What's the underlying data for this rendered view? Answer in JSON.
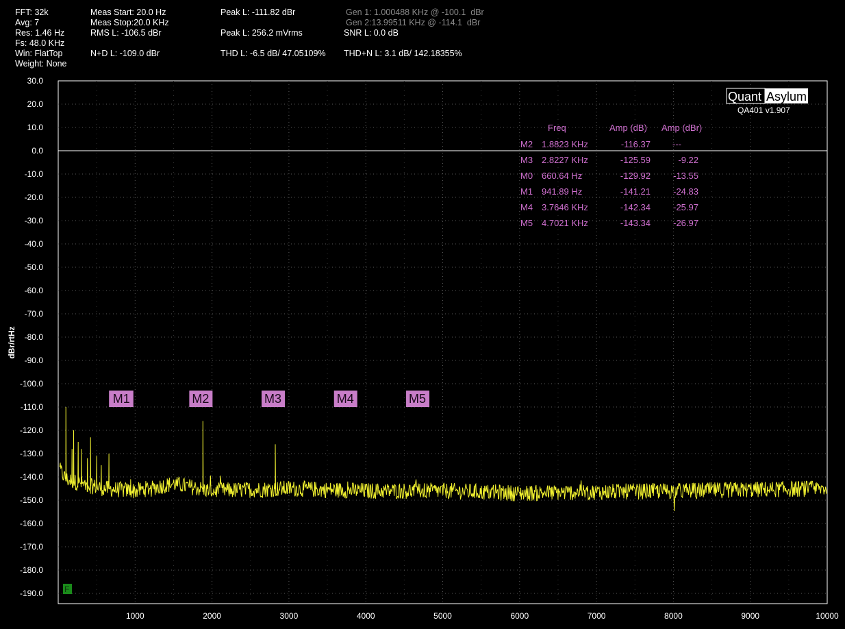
{
  "stats": {
    "fft": "FFT: 32k",
    "avg": "Avg: 7",
    "res": "Res: 1.46 Hz",
    "fs": "Fs: 48.0 KHz",
    "win": "Win: FlatTop",
    "weight": "Weight: None",
    "meas_start": "Meas Start: 20.0 Hz",
    "meas_stop": "Meas Stop:20.0 KHz",
    "rms": "RMS L: -106.5 dBr",
    "nd": "N+D L: -109.0 dBr",
    "peak_dbr": "Peak L: -111.82 dBr",
    "peak_mv": "Peak L: 256.2 mVrms",
    "thd": "THD L: -6.5 dB/ 47.05109%",
    "gen1": "Gen 1: 1.000488 KHz @ -100.1  dBr",
    "gen2": "Gen 2:13.99511 KHz @ -114.1  dBr",
    "snr": "SNR L: 0.0 dB",
    "thdn": "THD+N L: 3.1 dB/ 142.18355%"
  },
  "logo": {
    "quant": "Quant",
    "asylum": "Asylum",
    "version": "QA401 v1.907"
  },
  "colors": {
    "trace": "#f2f230",
    "marker": "#c87dc8",
    "table": "#d070d0",
    "grid": "#5a5a5a"
  },
  "badge": "F",
  "chart_data": {
    "type": "line",
    "xlim": [
      0,
      10000
    ],
    "ylim": [
      -195,
      30
    ],
    "ylabel": "dBr/rtHz",
    "xticks": [
      "1000",
      "2000",
      "3000",
      "4000",
      "5000",
      "6000",
      "7000",
      "8000",
      "9000",
      "10000"
    ],
    "yticks": [
      "30.0",
      "20.0",
      "10.0",
      "0.0",
      "-10.0",
      "-20.0",
      "-30.0",
      "-40.0",
      "-50.0",
      "-60.0",
      "-70.0",
      "-80.0",
      "-90.0",
      "-100.0",
      "-110.0",
      "-120.0",
      "-130.0",
      "-140.0",
      "-150.0",
      "-160.0",
      "-170.0",
      "-180.0",
      "-190.0"
    ],
    "reference_line_y": 0,
    "grid": true,
    "noise_floor": [
      [
        20,
        -137
      ],
      [
        100,
        -141
      ],
      [
        300,
        -143
      ],
      [
        600,
        -145
      ],
      [
        1000,
        -146
      ],
      [
        1500,
        -143
      ],
      [
        2000,
        -146
      ],
      [
        3000,
        -145
      ],
      [
        4000,
        -146
      ],
      [
        5000,
        -146
      ],
      [
        6000,
        -147
      ],
      [
        8000,
        -146
      ],
      [
        10000,
        -145
      ]
    ],
    "spikes": [
      [
        100,
        -110
      ],
      [
        180,
        -128
      ],
      [
        200,
        -120
      ],
      [
        260,
        -125
      ],
      [
        300,
        -128
      ],
      [
        380,
        -132
      ],
      [
        420,
        -123
      ],
      [
        500,
        -131
      ],
      [
        560,
        -135
      ],
      [
        660,
        -130
      ],
      [
        942,
        -141
      ],
      [
        1882,
        -116
      ],
      [
        2823,
        -126
      ],
      [
        3765,
        -142
      ],
      [
        4702,
        -143
      ]
    ],
    "markers_table": {
      "headers": [
        "",
        "Freq",
        "Amp (dB)",
        "Amp (dBr)"
      ],
      "rows": [
        [
          "M2",
          "1.8823 KHz",
          "-116.37",
          "---"
        ],
        [
          "M3",
          "2.8227 KHz",
          "-125.59",
          "-9.22"
        ],
        [
          "M0",
          "660.64 Hz",
          "-129.92",
          "-13.55"
        ],
        [
          "M1",
          "941.89 Hz",
          "-141.21",
          "-24.83"
        ],
        [
          "M4",
          "3.7646 KHz",
          "-142.34",
          "-25.97"
        ],
        [
          "M5",
          "4.7021 KHz",
          "-143.34",
          "-26.97"
        ]
      ]
    },
    "markers": [
      {
        "name": "M0",
        "x": 660.64,
        "y": -129.92
      },
      {
        "name": "M1",
        "x": 941.89,
        "y": -141.21
      },
      {
        "name": "M2",
        "x": 1882.3,
        "y": -116.37
      },
      {
        "name": "M3",
        "x": 2822.7,
        "y": -125.59
      },
      {
        "name": "M4",
        "x": 3764.6,
        "y": -142.34
      },
      {
        "name": "M5",
        "x": 4702.1,
        "y": -143.34
      }
    ]
  }
}
